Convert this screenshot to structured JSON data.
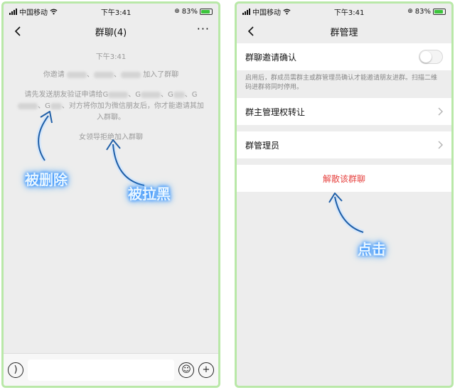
{
  "left_screen": {
    "status": {
      "carrier": "中国移动",
      "time": "下午3:41",
      "battery": "83%"
    },
    "nav": {
      "title": "群聊(4)",
      "more": "···"
    },
    "chat": {
      "timestamp": "下午3:41",
      "msg1_prefix": "你邀请",
      "msg1_suffix": "加入了群聊",
      "msg2_part1": "请先发送朋友验证申请给G",
      "msg2_sep1": "、G",
      "msg2_sep2": "、G",
      "msg2_sep3": "、G",
      "msg2_sep4": "、G",
      "msg2_part2": "、对方将你加为微信朋友后，你才能邀请其加入群聊。",
      "msg3": "女领导拒绝加入群聊"
    },
    "annotations": {
      "deleted": "被删除",
      "blocked": "被拉黑"
    },
    "input": {
      "voice_icon": "voice-icon",
      "emoji_icon": "emoji-icon",
      "plus_icon": "plus-icon"
    }
  },
  "right_screen": {
    "status": {
      "carrier": "中国移动",
      "time": "下午3:41",
      "battery": "83%"
    },
    "nav": {
      "title": "群管理"
    },
    "settings": {
      "invite_confirm_label": "群聊邀请确认",
      "invite_confirm_on": false,
      "invite_confirm_desc": "启用后，群成员需群主或群管理员确认才能邀请朋友进群。扫描二维码进群将同时停用。",
      "transfer_owner": "群主管理权转让",
      "admins": "群管理员",
      "dissolve": "解散该群聊"
    },
    "annotations": {
      "click": "点击"
    }
  },
  "colors": {
    "accent_glow": "#2a8cff",
    "danger": "#e64340",
    "frame": "#b9e8a8",
    "background": "#ededed"
  }
}
